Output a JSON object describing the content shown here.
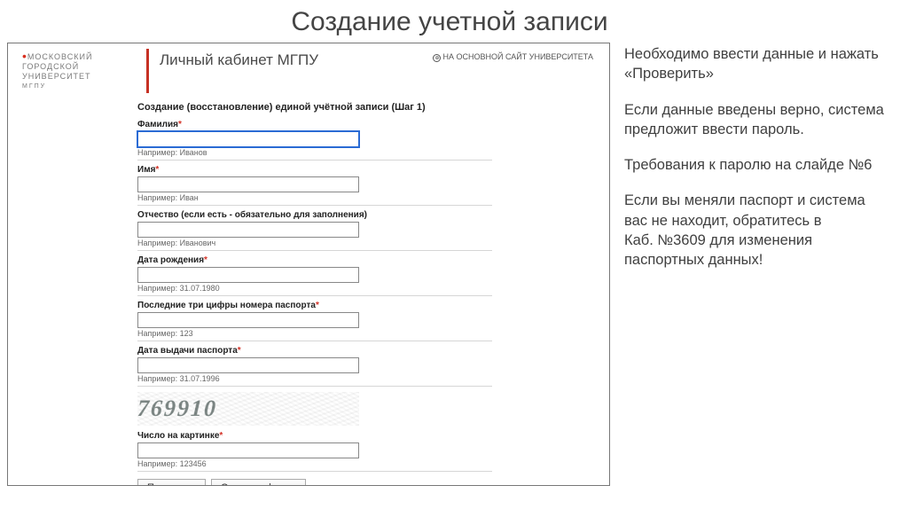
{
  "slide_title": "Создание учетной записи",
  "browser": {
    "logo_line1": "МОСКОВСКИЙ",
    "logo_line2": "ГОРОДСКОЙ",
    "logo_line3": "УНИВЕРСИТЕТ",
    "logo_line4": "МГПУ",
    "cabinet_title": "Личный кабинет МГПУ",
    "main_site_link": "НА ОСНОВНОЙ САЙТ УНИВЕРСИТЕТА",
    "form_title": "Создание (восстановление) единой учётной записи (Шаг 1)",
    "fields": {
      "surname": {
        "label": "Фамилия",
        "req": "*",
        "hint": "Например: Иванов"
      },
      "name": {
        "label": "Имя",
        "req": "*",
        "hint": "Например: Иван"
      },
      "patronymic": {
        "label": "Отчество (если есть - обязательно для заполнения)",
        "req": "",
        "hint": "Например: Иванович"
      },
      "dob": {
        "label": "Дата рождения",
        "req": "*",
        "hint": "Например: 31.07.1980"
      },
      "passport3": {
        "label": "Последние три цифры номера паспорта",
        "req": "*",
        "hint": "Например: 123"
      },
      "passport_date": {
        "label": "Дата выдачи паспорта",
        "req": "*",
        "hint": "Например: 31.07.1996"
      },
      "captcha": {
        "label": "Число на картинке",
        "req": "*",
        "hint": "Например: 123456"
      }
    },
    "captcha_value": "769910",
    "buttons": {
      "check": "Проверить",
      "clear": "Очистить форму"
    }
  },
  "side": {
    "p1": "Необходимо ввести данные и  нажать",
    "p1q": "«Проверить»",
    "p2": "Если данные введены верно, система предложит ввести пароль.",
    "p3": "Требования к паролю на слайде №6",
    "p4": "Если вы меняли паспорт и система вас не находит, обратитесь в",
    "p4b": "Каб. №3609 для изменения паспортных данных!"
  }
}
